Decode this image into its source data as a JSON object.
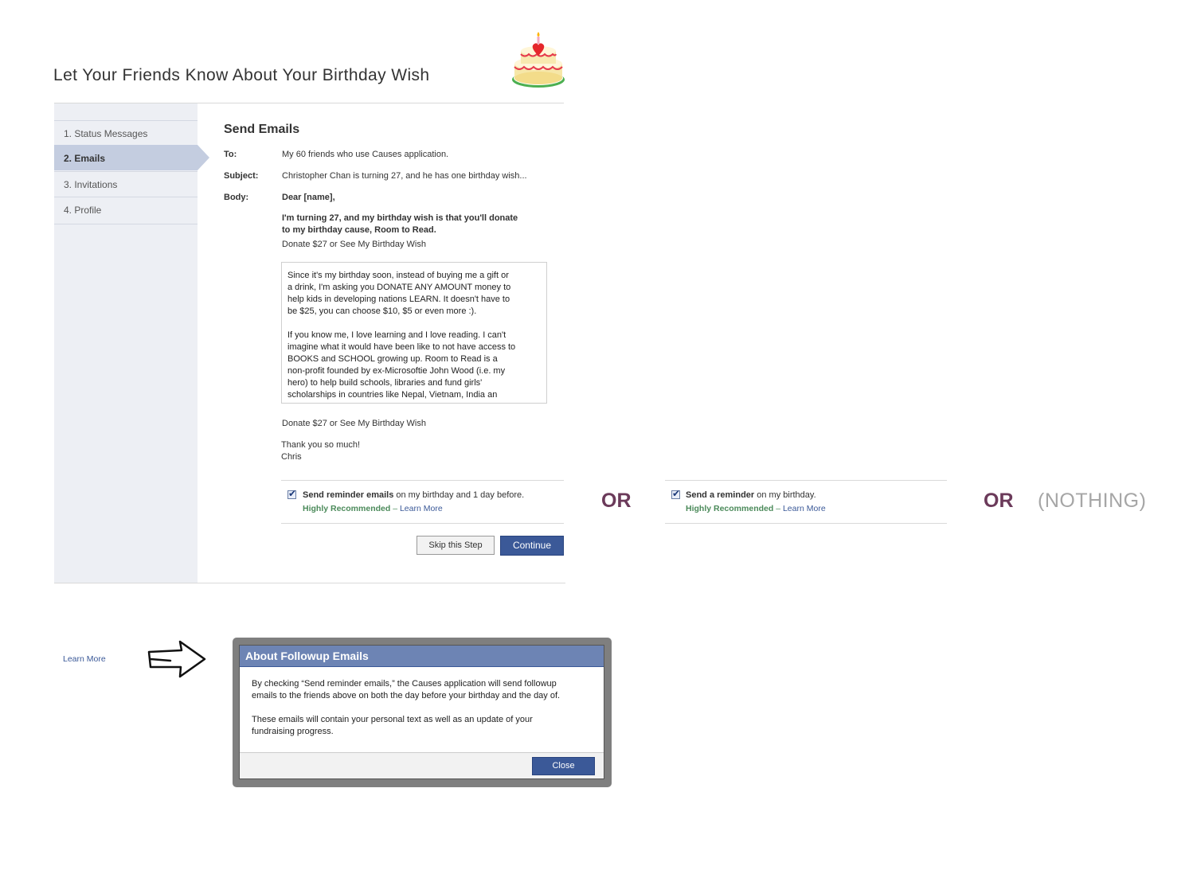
{
  "header": {
    "title": "Let Your Friends Know About Your Birthday Wish",
    "image": "birthday-cake-icon"
  },
  "steps": [
    {
      "label": "1. Status Messages",
      "active": false
    },
    {
      "label": "2. Emails",
      "active": true
    },
    {
      "label": "3. Invitations",
      "active": false
    },
    {
      "label": "4. Profile",
      "active": false
    }
  ],
  "email": {
    "section_title": "Send Emails",
    "to_label": "To:",
    "to_value": "My 60 friends who use Causes application.",
    "subject_label": "Subject:",
    "subject_value": "Christopher Chan is turning 27, and he has one birthday wish...",
    "body_label": "Body:",
    "greeting": "Dear [name],",
    "wish_line1": "I'm turning 27, and my birthday wish is that you'll donate",
    "wish_line2": "to my birthday cause, Room to Read.",
    "donate_link_top": "Donate $27 or See My Birthday Wish",
    "message_lines_p1": [
      "Since it's my birthday soon, instead of buying me a gift or",
      "a drink, I'm asking you DONATE ANY AMOUNT money to",
      "help kids in developing nations LEARN. It doesn't have to",
      "be $25, you can choose $10, $5 or even more :)."
    ],
    "message_lines_p2": [
      "If you know me, I love learning and I love reading. I can't",
      "imagine what it would have been like to not have access to",
      "BOOKS and SCHOOL growing up. Room to Read is a",
      "non-profit founded by ex-Microsoftie John Wood (i.e. my",
      "hero) to help build schools, libraries and fund girls'",
      "scholarships in countries like Nepal, Vietnam, India an"
    ],
    "donate_link_bottom": "Donate $27 or See My Birthday Wish",
    "signoff": "Thank you so much!",
    "signature": "Chris"
  },
  "reminder_a": {
    "checked": true,
    "bold_text": "Send reminder emails",
    "rest_text": " on my birthday and 1 day before.",
    "recommended": "Highly Recommended",
    "dash": " – ",
    "learn_more": "Learn More"
  },
  "reminder_b": {
    "checked": true,
    "bold_text": "Send a reminder",
    "rest_text": " on my birthday.",
    "recommended": "Highly Recommended",
    "dash": " – ",
    "learn_more": "Learn More"
  },
  "alternatives": {
    "or1": "OR",
    "or2": "OR",
    "nothing": "(NOTHING)"
  },
  "buttons": {
    "skip": "Skip this Step",
    "continue": "Continue"
  },
  "demo": {
    "learn_more": "Learn More",
    "arrow": "right-arrow-icon"
  },
  "dialog": {
    "title": "About Followup Emails",
    "p1_line1": "By checking “Send reminder emails,” the Causes application will send followup",
    "p1_line2": "emails to the friends above on both the day before your birthday and the day of.",
    "p2_line1": "These emails will contain your personal text as well as an update of your",
    "p2_line2": "fundraising progress.",
    "close": "Close"
  },
  "colors": {
    "brand": "#3b5998",
    "dialog_header": "#6d84b4",
    "sidebar": "#edeff4",
    "active_step": "#c4cde0",
    "or_text": "#6b3a5a",
    "recommended": "#4b8a5a"
  }
}
